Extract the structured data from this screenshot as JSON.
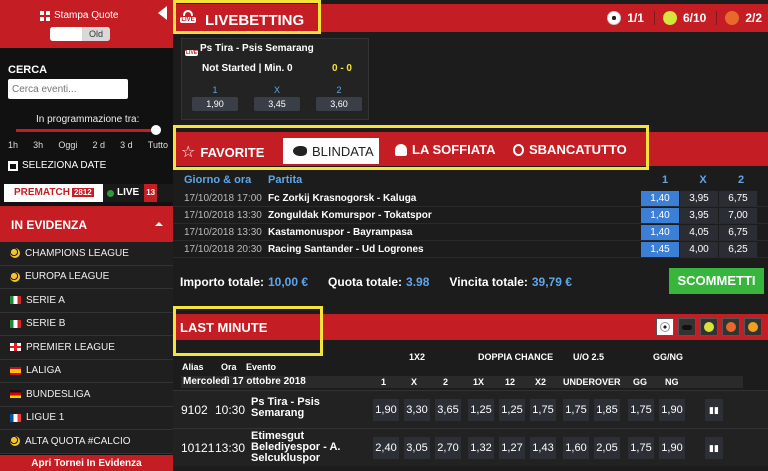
{
  "sidebar": {
    "stampa_label": "Stampa Quote",
    "toggle_label": "Old",
    "cerca_label": "CERCA",
    "cerca_placeholder": "Cerca eventi...",
    "programmazione_label": "In programmazione tra:",
    "time_filters": [
      "1h",
      "3h",
      "Oggi",
      "2 d",
      "3 d",
      "Tutto"
    ],
    "seleziona_date": "SELEZIONA DATE",
    "tab_prematch": "PREMATCH",
    "tab_prematch_count": "2812",
    "tab_live": "LIVE",
    "tab_live_count": "13",
    "evidenza_title": "IN EVIDENZA",
    "leagues": [
      {
        "label": "CHAMPIONS LEAGUE",
        "icon": "ball"
      },
      {
        "label": "EUROPA LEAGUE",
        "icon": "ball"
      },
      {
        "label": "SERIE A",
        "icon": "it"
      },
      {
        "label": "SERIE B",
        "icon": "it"
      },
      {
        "label": "PREMIER LEAGUE",
        "icon": "en"
      },
      {
        "label": "LALIGA",
        "icon": "es"
      },
      {
        "label": "BUNDESLIGA",
        "icon": "de"
      },
      {
        "label": "LIGUE 1",
        "icon": "fr"
      },
      {
        "label": "ALTA QUOTA #CALCIO",
        "icon": "ball"
      }
    ],
    "apri_label": "Apri Tornei In Evidenza"
  },
  "livebetting": {
    "title": "LIVEBETTING",
    "live_tag": "LIVE",
    "stats": [
      {
        "icon": "soccer",
        "value": "1/1"
      },
      {
        "icon": "tennis",
        "value": "6/10"
      },
      {
        "icon": "basket",
        "value": "2/2"
      }
    ],
    "match": {
      "teams": "Ps Tira - Psis Semarang",
      "status": "Not Started | Min. 0",
      "score": "0 - 0",
      "labels": [
        "1",
        "X",
        "2"
      ],
      "odds": [
        "1,90",
        "3,45",
        "3,60"
      ]
    }
  },
  "favorite": {
    "tabs": {
      "favorite": "FAVORITE",
      "blindata": "BLINDATA",
      "soffiata": "LA SOFFIATA",
      "sbancatutto": "SBANCATUTTO"
    },
    "headers": {
      "date": "Giorno & ora",
      "match": "Partita",
      "h1": "1",
      "hx": "X",
      "h2": "2"
    },
    "rows": [
      {
        "date": "17/10/2018 17:00",
        "event": "Fc Zorkij Krasnogorsk - Kaluga",
        "odds": [
          "1,40",
          "3,95",
          "6,75"
        ],
        "selected": 0
      },
      {
        "date": "17/10/2018 13:30",
        "event": "Zonguldak Komurspor - Tokatspor",
        "odds": [
          "1,40",
          "3,95",
          "7,00"
        ],
        "selected": 0
      },
      {
        "date": "17/10/2018 13:30",
        "event": "Kastamonuspor - Bayrampasa",
        "odds": [
          "1,40",
          "4,05",
          "6,75"
        ],
        "selected": 0
      },
      {
        "date": "17/10/2018 20:30",
        "event": "Racing Santander - Ud Logrones",
        "odds": [
          "1,45",
          "4,00",
          "6,25"
        ],
        "selected": 0
      }
    ],
    "importo_label": "Importo totale:",
    "importo_value": "10,00 €",
    "quota_label": "Quota totale:",
    "quota_value": "3.98",
    "vincita_label": "Vincita totale:",
    "vincita_value": "39,79 €",
    "scommetti": "SCOMMETTI"
  },
  "last_minute": {
    "title": "LAST MINUTE",
    "groups": [
      "1X2",
      "DOPPIA CHANCE",
      "U/O 2.5",
      "GG/NG"
    ],
    "sub_headers": {
      "alias": "Alias",
      "ora": "Ora",
      "evento": "Evento"
    },
    "date_label": "Mercoledì 17 ottobre 2018",
    "columns": [
      "1",
      "X",
      "2",
      "1X",
      "12",
      "X2",
      "UNDER",
      "OVER",
      "GG",
      "NG"
    ],
    "rows": [
      {
        "alias": "9102",
        "ora": "10:30",
        "event": "Ps Tira - Psis Semarang",
        "odds": [
          "1,90",
          "3,30",
          "3,65",
          "1,25",
          "1,25",
          "1,75",
          "1,75",
          "1,85",
          "1,75",
          "1,90"
        ]
      },
      {
        "alias": "10121",
        "ora": "13:30",
        "event": "Etimesgut Belediyespor - A. Selcukluspor",
        "odds": [
          "2,40",
          "3,05",
          "2,70",
          "1,32",
          "1,27",
          "1,43",
          "1,60",
          "2,05",
          "1,75",
          "1,90"
        ]
      }
    ]
  }
}
